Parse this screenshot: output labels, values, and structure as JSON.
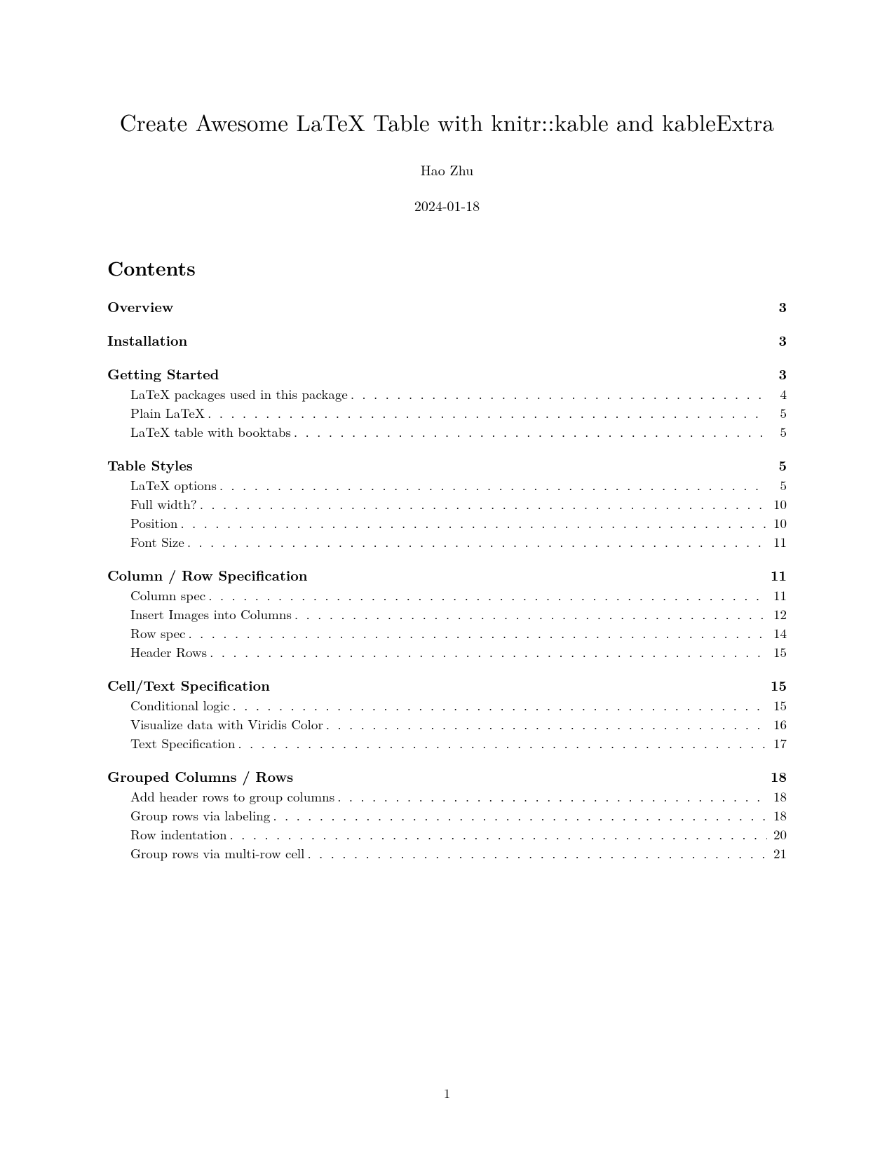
{
  "title": "Create Awesome LaTeX Table with knitr::kable and kableExtra",
  "author": "Hao Zhu",
  "date": "2024-01-18",
  "contents_heading": "Contents",
  "page_number": "1",
  "toc": [
    {
      "label": "Overview",
      "page": "3",
      "subs": []
    },
    {
      "label": "Installation",
      "page": "3",
      "subs": []
    },
    {
      "label": "Getting Started",
      "page": "3",
      "subs": [
        {
          "label": "LaTeX packages used in this package",
          "page": "4"
        },
        {
          "label": "Plain LaTeX",
          "page": "5"
        },
        {
          "label": "LaTeX table with booktabs",
          "page": "5"
        }
      ]
    },
    {
      "label": "Table Styles",
      "page": "5",
      "subs": [
        {
          "label": "LaTeX options",
          "page": "5"
        },
        {
          "label": "Full width?",
          "page": "10"
        },
        {
          "label": "Position",
          "page": "10"
        },
        {
          "label": "Font Size",
          "page": "11"
        }
      ]
    },
    {
      "label": "Column / Row Specification",
      "page": "11",
      "subs": [
        {
          "label": "Column spec",
          "page": "11"
        },
        {
          "label": "Insert Images into Columns",
          "page": "12"
        },
        {
          "label": "Row spec",
          "page": "14"
        },
        {
          "label": "Header Rows",
          "page": "15"
        }
      ]
    },
    {
      "label": "Cell/Text Specification",
      "page": "15",
      "subs": [
        {
          "label": "Conditional logic",
          "page": "15"
        },
        {
          "label": "Visualize data with Viridis Color",
          "page": "16"
        },
        {
          "label": "Text Specification",
          "page": "17"
        }
      ]
    },
    {
      "label": "Grouped Columns / Rows",
      "page": "18",
      "subs": [
        {
          "label": "Add header rows to group columns",
          "page": "18"
        },
        {
          "label": "Group rows via labeling",
          "page": "18"
        },
        {
          "label": "Row indentation",
          "page": "20"
        },
        {
          "label": "Group rows via multi-row cell",
          "page": "21"
        }
      ]
    }
  ]
}
